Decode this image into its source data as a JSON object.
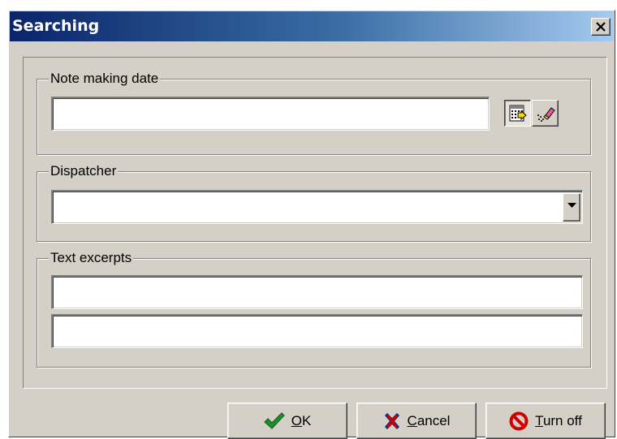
{
  "window": {
    "title": "Searching"
  },
  "groups": {
    "date": {
      "label": "Note making date",
      "value": ""
    },
    "dispatcher": {
      "label": "Dispatcher",
      "value": ""
    },
    "excerpts": {
      "label": "Text excerpts",
      "value1": "",
      "value2": ""
    }
  },
  "buttons": {
    "ok": {
      "mnemonic": "O",
      "rest": "K"
    },
    "cancel": {
      "mnemonic": "C",
      "rest": "ancel"
    },
    "turnoff": {
      "mnemonic": "T",
      "rest": "urn off"
    }
  },
  "icons": {
    "close": "close-icon",
    "calendar": "calendar-icon",
    "clear": "eraser-icon",
    "dropdown": "chevron-down-icon",
    "ok": "checkmark-icon",
    "cancel": "cross-icon",
    "turnoff": "no-entry-icon"
  },
  "colors": {
    "face": "#d4d0c8",
    "title_start": "#0a246a",
    "title_end": "#a6caf0",
    "ok_green": "#1f8f2a",
    "cancel_blue": "#0a2a8a",
    "stop_red": "#d00000"
  }
}
